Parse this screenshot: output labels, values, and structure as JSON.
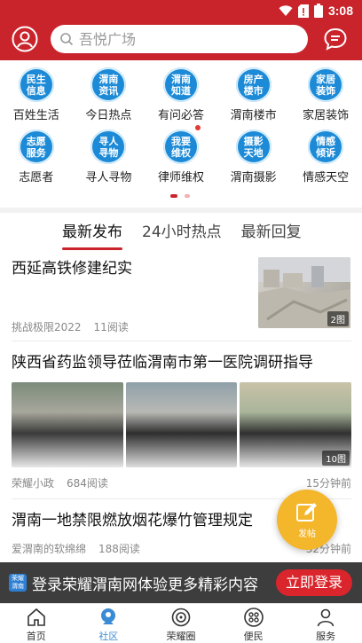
{
  "status_bar": {
    "time": "3:08"
  },
  "search": {
    "placeholder": "吾悦广场"
  },
  "grid": {
    "row1": [
      {
        "icon_text": "民生信息",
        "label": "百姓生活"
      },
      {
        "icon_text": "渭南资讯",
        "label": "今日热点"
      },
      {
        "icon_text": "渭南知道",
        "label": "有问必答"
      },
      {
        "icon_text": "房产楼市",
        "label": "渭南楼市"
      },
      {
        "icon_text": "家居装饰",
        "label": "家居装饰"
      }
    ],
    "row2": [
      {
        "icon_text": "志愿服务",
        "label": "志愿者"
      },
      {
        "icon_text": "寻人寻物",
        "label": "寻人寻物"
      },
      {
        "icon_text": "我要维权",
        "label": "律师维权"
      },
      {
        "icon_text": "摄影天地",
        "label": "渭南摄影"
      },
      {
        "icon_text": "情感倾诉",
        "label": "情感天空"
      }
    ]
  },
  "tabs": [
    "最新发布",
    "24小时热点",
    "最新回复"
  ],
  "feed": [
    {
      "title": "西延高铁修建纪实",
      "author": "挑战极限2022",
      "reads": "11阅读",
      "img_count": "2图"
    },
    {
      "title": "陕西省药监领导莅临渭南市第一医院调研指导",
      "author": "荣耀小政",
      "reads": "684阅读",
      "time": "15分钟前",
      "img_count": "10图"
    },
    {
      "title": "渭南一地禁限燃放烟花爆竹管理规定",
      "author": "爱渭南的软绵绵",
      "reads": "188阅读",
      "time": "32分钟前"
    }
  ],
  "fab": {
    "label": "发帖"
  },
  "banner": {
    "logo_text": "荣耀渭南",
    "text": "登录荣耀渭南网体验更多精彩内容",
    "button": "立即登录"
  },
  "bottom_nav": [
    {
      "label": "首页"
    },
    {
      "label": "社区"
    },
    {
      "label": "荣耀圈"
    },
    {
      "label": "便民"
    },
    {
      "label": "服务"
    }
  ],
  "colors": {
    "brand_red": "#c9242b",
    "icon_blue": "#1c8ad6",
    "fab_yellow": "#f4b62a",
    "active_nav": "#3a8bd6"
  }
}
